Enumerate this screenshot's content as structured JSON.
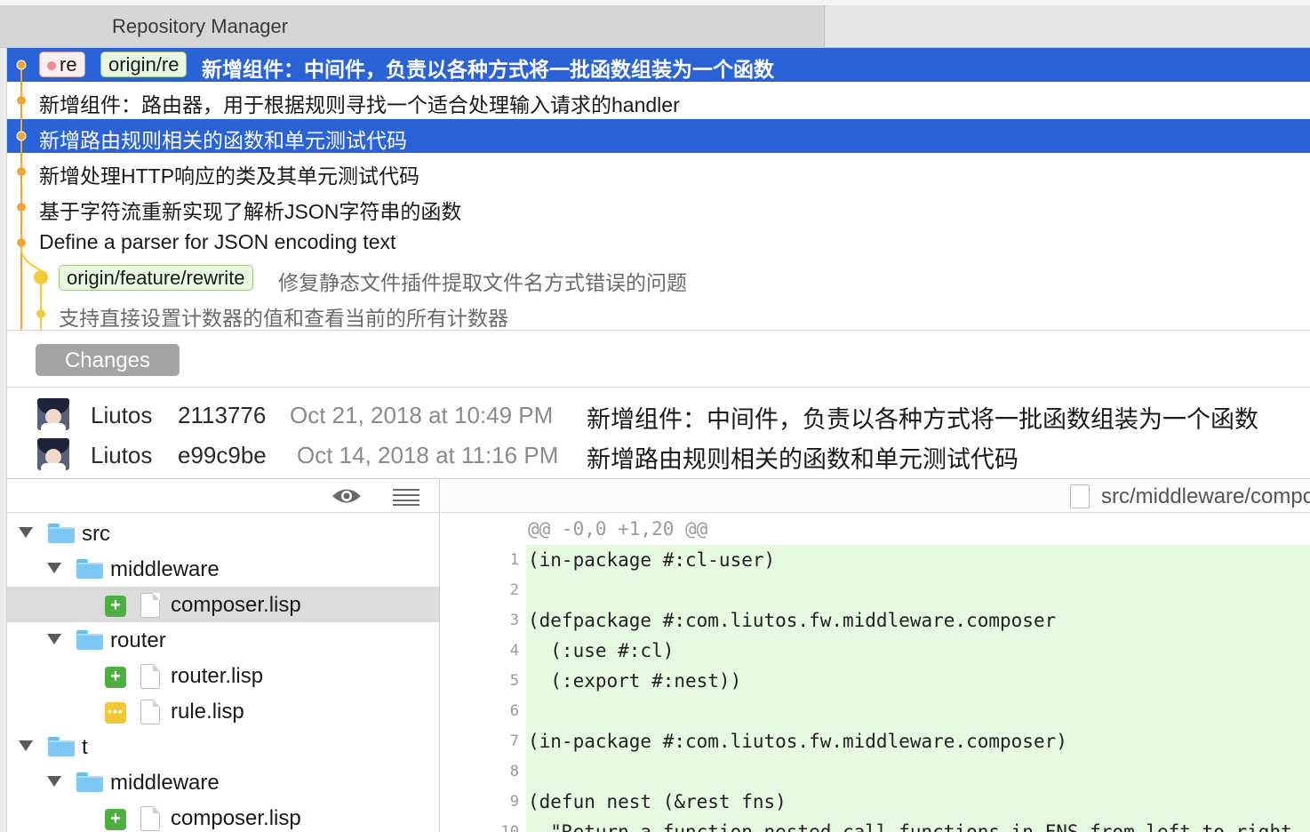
{
  "window": {
    "tab_title": "Repository Manager"
  },
  "commits": [
    {
      "local_branch": "re",
      "remote_branch": "origin/re",
      "message": "新增组件：中间件，负责以各种方式将一批函数组装为一个函数",
      "selected": true
    },
    {
      "message": "新增组件：路由器，用于根据规则寻找一个适合处理输入请求的handler",
      "selected": false
    },
    {
      "message": "新增路由规则相关的函数和单元测试代码",
      "selected": true
    },
    {
      "message": "新增处理HTTP响应的类及其单元测试代码",
      "selected": false
    },
    {
      "message": "基于字符流重新实现了解析JSON字符串的函数",
      "selected": false
    },
    {
      "message": "Define a parser for JSON encoding text",
      "selected": false
    },
    {
      "remote_branch": "origin/feature/rewrite",
      "message": "修复静态文件插件提取文件名方式错误的问题",
      "selected": false
    },
    {
      "message": "支持直接设置计数器的值和查看当前的所有计数器",
      "selected": false
    }
  ],
  "changes": {
    "button_label": "Changes",
    "entries": [
      {
        "author": "Liutos",
        "sha": "2113776",
        "date": "Oct 21, 2018 at 10:49 PM",
        "subject": "新增组件：中间件，负责以各种方式将一批函数组装为一个函数"
      },
      {
        "author": "Liutos",
        "sha": "e99c9be",
        "date": "Oct 14, 2018 at 11:16 PM",
        "subject": "新增路由规则相关的函数和单元测试代码"
      }
    ]
  },
  "file_tree": [
    {
      "name": "src",
      "kind": "folder",
      "depth": 0
    },
    {
      "name": "middleware",
      "kind": "folder",
      "depth": 1
    },
    {
      "name": "composer.lisp",
      "kind": "file",
      "depth": 2,
      "status": "added",
      "selected": true
    },
    {
      "name": "router",
      "kind": "folder",
      "depth": 1
    },
    {
      "name": "router.lisp",
      "kind": "file",
      "depth": 2,
      "status": "added"
    },
    {
      "name": "rule.lisp",
      "kind": "file",
      "depth": 2,
      "status": "modified"
    },
    {
      "name": "t",
      "kind": "folder",
      "depth": 0
    },
    {
      "name": "middleware",
      "kind": "folder",
      "depth": 1
    },
    {
      "name": "composer.lisp",
      "kind": "file",
      "depth": 2,
      "status": "added"
    }
  ],
  "diff": {
    "file_path": "src/middleware/composer.lisp",
    "hunk_header": "@@ -0,0 +1,20 @@",
    "lines": [
      {
        "n": "1",
        "text": "(in-package #:cl-user)"
      },
      {
        "n": "2",
        "text": ""
      },
      {
        "n": "3",
        "text": "(defpackage #:com.liutos.fw.middleware.composer"
      },
      {
        "n": "4",
        "text": "  (:use #:cl)"
      },
      {
        "n": "5",
        "text": "  (:export #:nest))"
      },
      {
        "n": "6",
        "text": ""
      },
      {
        "n": "7",
        "text": "(in-package #:com.liutos.fw.middleware.composer)"
      },
      {
        "n": "8",
        "text": ""
      },
      {
        "n": "9",
        "text": "(defun nest (&rest fns)"
      },
      {
        "n": "10",
        "text": "  \"Return a function nested call functions in FNS from left to right"
      }
    ]
  },
  "colors": {
    "selection": "#2a63d8",
    "graph_main": "#f0a53c",
    "graph_branch": "#f4c93a",
    "added": "#4caf3f",
    "modified": "#f2c735",
    "diff_added_bg": "#e6fae2"
  },
  "icons": {
    "preview": "eye-icon",
    "list_view": "list-icon",
    "folder": "folder-icon",
    "file": "file-icon"
  }
}
